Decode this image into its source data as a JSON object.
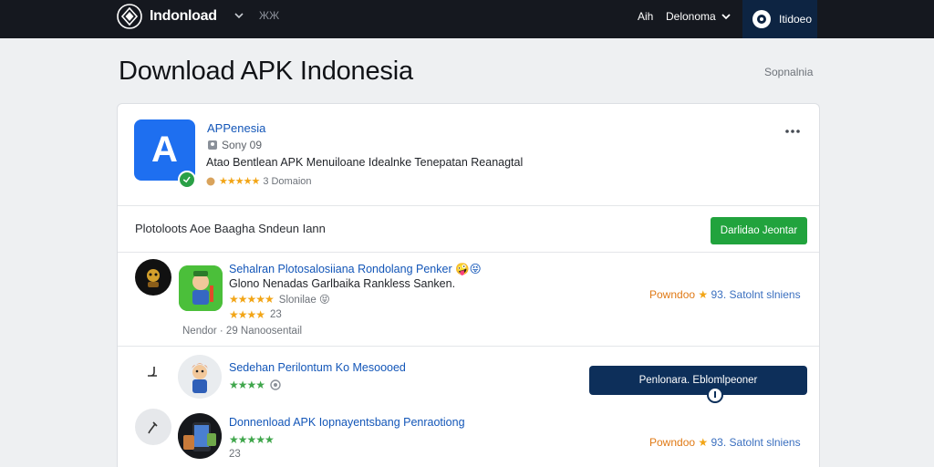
{
  "nav": {
    "brand": "Indonload",
    "extra": "ЖЖ",
    "link_a": "Aih",
    "link_b": "Delonoma",
    "user_label": "Itidoeo"
  },
  "page": {
    "title": "Download APK Indonesia",
    "aside": "Sopnalnia"
  },
  "app": {
    "icon_letter": "A",
    "name": "APPenesia",
    "developer": "Sony 09",
    "description": "Atao Bentlean APK Menuiloane Idealnke Tenepatan Reanagtal",
    "rating_text": "3 Domaion",
    "stars": "★★★★★"
  },
  "section": {
    "label": "Plotoloots Aoe Baagha Sndeun Iann",
    "button": "Darlidao Jeontar"
  },
  "rows": [
    {
      "title": "Sehalran Plotosalosiiana Rondolang Penker 🤪😝",
      "sub": "Glono Nenadas Garlbaika Rankless Sanken.",
      "stars_a": "★★★★★",
      "rating_label": "Slonilae 😝",
      "stars_b": "★★★★",
      "count": "23",
      "meta": "Nendor · 29 Nanoosentail",
      "right_prefix": "Powndoo",
      "right_star": "★",
      "right_rest": "93. Satolnt slniens"
    },
    {
      "title": "Sedehan Perilontum Ko Mesoooed",
      "stars_a": "★★★★",
      "button": "Penlonara. Eblomlpeoner"
    },
    {
      "title": "Donnenload APK Iopnayentsbang Penraotiong",
      "stars_a": "★★★★★",
      "count": "23",
      "right_prefix": "Powndoo",
      "right_star": "★",
      "right_rest": "93. Satolnt slniens"
    }
  ],
  "colors": {
    "topbar": "#15181f",
    "accent_blue": "#1e6ff0",
    "link_blue": "#1356b8",
    "green_button": "#21a33d",
    "navy_button": "#0d2f5a",
    "star_gold": "#f2a516",
    "download_orange": "#e07a16"
  }
}
